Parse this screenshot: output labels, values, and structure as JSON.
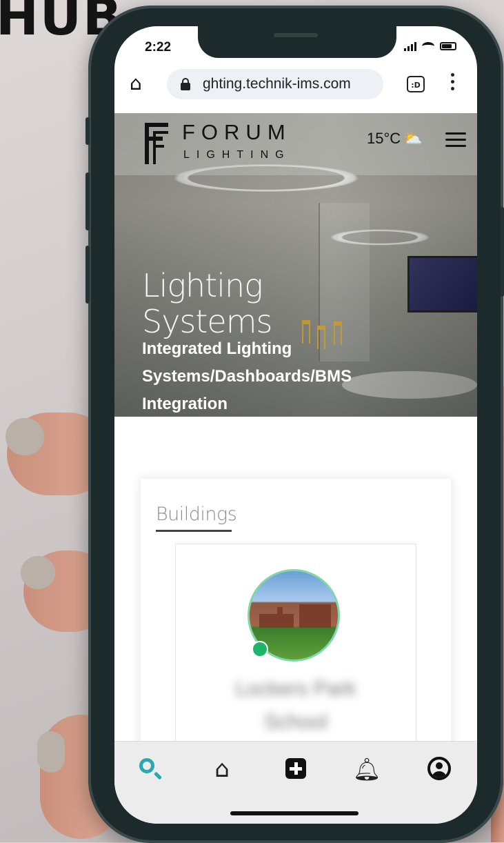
{
  "corner_text": "HUB",
  "status_bar": {
    "time": "2:22"
  },
  "browser": {
    "url": "ghting.technik-ims.com",
    "tab_count_label": ":D"
  },
  "header": {
    "brand_top": "FORUM",
    "brand_bottom": "LIGHTING",
    "temperature": "15°C",
    "weather_icon": "partly-cloudy-icon"
  },
  "hero": {
    "title": "Lighting Systems",
    "subtitle": "Integrated Lighting Systems/Dashboards/BMS Integration"
  },
  "buildings": {
    "section_title": "Buildings",
    "items": [
      {
        "name": "Lockers Park School",
        "status": "online"
      }
    ]
  },
  "tabbar": {
    "items": [
      {
        "icon": "search-icon",
        "active": true
      },
      {
        "icon": "home-icon",
        "active": false
      },
      {
        "icon": "add-icon",
        "active": false
      },
      {
        "icon": "bell-icon",
        "active": false
      },
      {
        "icon": "user-icon",
        "active": false
      }
    ]
  },
  "colors": {
    "accent": "#2aa7b0",
    "online": "#1db56b",
    "avatar_ring": "#7fd7a8"
  }
}
